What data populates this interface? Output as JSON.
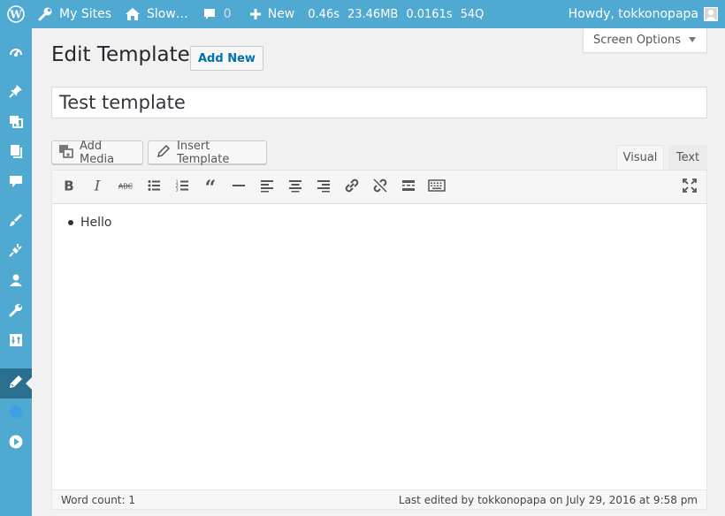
{
  "admin_bar": {
    "my_sites": "My Sites",
    "site_name": "Slow…",
    "comments_count": "0",
    "new_label": "New",
    "perf_time": "0.46s",
    "perf_memory": "23.46MB",
    "perf_query_time": "0.0161s",
    "perf_queries": "54Q",
    "howdy": "Howdy, tokkonopapa"
  },
  "sidebar": {
    "items": [
      {
        "icon": "dashboard-icon"
      },
      {
        "icon": "pin-icon"
      },
      {
        "icon": "media-icon"
      },
      {
        "icon": "pages-icon"
      },
      {
        "icon": "comments-icon"
      },
      {
        "icon": "appearance-icon"
      },
      {
        "icon": "plugins-icon"
      },
      {
        "icon": "users-icon"
      },
      {
        "icon": "tools-icon"
      },
      {
        "icon": "settings-icon"
      },
      {
        "icon": "templates-icon",
        "current": true
      },
      {
        "icon": "circle-icon"
      },
      {
        "icon": "play-icon"
      }
    ]
  },
  "screen_options": "Screen Options",
  "page": {
    "title": "Edit Template",
    "add_new": "Add New"
  },
  "title_field": {
    "value": "Test template"
  },
  "media_buttons": {
    "add_media": "Add Media",
    "insert_template": "Insert Template"
  },
  "editor_tabs": {
    "visual": "Visual",
    "text": "Text"
  },
  "toolbar": {
    "buttons": [
      "bold",
      "italic",
      "strikethrough",
      "bulleted-list",
      "numbered-list",
      "blockquote",
      "horizontal-line",
      "align-left",
      "align-center",
      "align-right",
      "insert-link",
      "remove-link",
      "read-more",
      "toolbar-toggle",
      "fullscreen"
    ]
  },
  "content": {
    "items": [
      "Hello"
    ]
  },
  "status": {
    "word_count": "Word count: 1",
    "last_edited": "Last edited by tokkonopapa on July 29, 2016 at 9:58 pm"
  },
  "colors": {
    "admin_bar": "#4fa9d0",
    "sidebar": "#4fa9d0",
    "sidebar_current": "#2b6f8e",
    "link": "#0073aa"
  }
}
